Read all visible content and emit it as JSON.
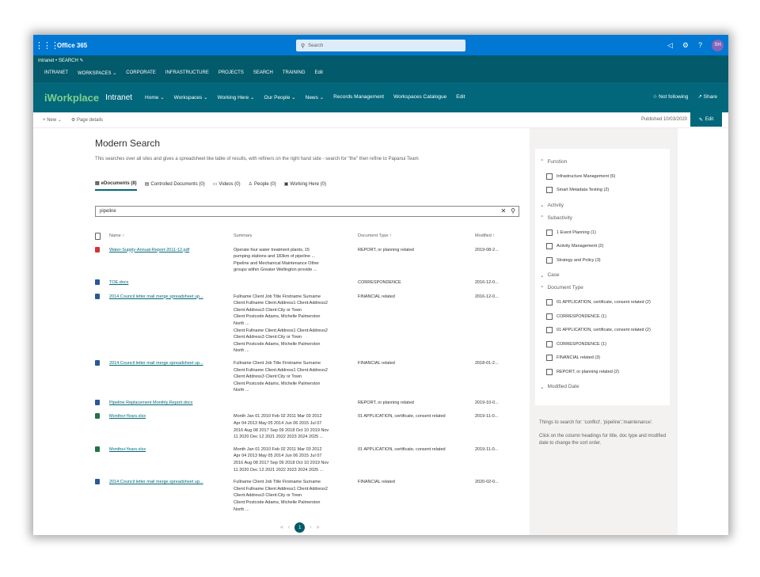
{
  "suitebar": {
    "app_name": "Office 365",
    "search_placeholder": "Search",
    "avatar_initials": "SH"
  },
  "hubnav": {
    "breadcrumb": [
      "Intranet",
      "SEARCH"
    ],
    "items": [
      "INTRANET",
      "WORKSPACES",
      "CORPORATE",
      "INFRASTRUCTURE",
      "PROJECTS",
      "SEARCH",
      "TRAINING",
      "Edit"
    ]
  },
  "site": {
    "logo": "iWorkplace",
    "title": "Intranet",
    "nav": [
      "Home",
      "Workspaces",
      "Working Here",
      "Our People",
      "News",
      "Records Management",
      "Workspaces Catalogue",
      "Edit"
    ],
    "follow_label": "Not following",
    "share_label": "Share"
  },
  "cmdbar": {
    "new_label": "New",
    "page_details_label": "Page details",
    "published": "Published 10/03/2020",
    "edit_label": "Edit"
  },
  "main": {
    "title": "Modern Search",
    "description": "This searches over all sites and gives a spreadsheet like table of results, with refiners on the right hand side - search for \"the\" then refine to Papanui Team",
    "tabs": [
      "eDocuments (8)",
      "Controlled Documents (0)",
      "Videos (0)",
      "People (0)",
      "Working Here (0)"
    ],
    "search_value": "pipeline",
    "columns": {
      "name": "Name",
      "summary": "Summary",
      "doc_type": "Document Type",
      "modified": "Modified"
    },
    "rows": [
      {
        "icon": "pdf",
        "name": "Water-Supply-Annual-Report-2011-12.pdf",
        "summary_lines": [
          "Operate four water treatment plants, 15",
          "pumping stations and 183km of pipeline ...",
          "Pipeline and Mechanical Maintenance Other",
          "groups within Greater Wellington provide ..."
        ],
        "doc_type": "REPORT, or planning related",
        "modified": "2019-08-2..."
      },
      {
        "icon": "word",
        "name": "TOE.docx",
        "summary_lines": [],
        "doc_type": "CORRESPONDENCE",
        "modified": "2016-12-0..."
      },
      {
        "icon": "word",
        "name": "2014 Council letter mail merge spreadsheet up...",
        "summary_lines": [
          "Fullname Client Job Title Firstname Surname",
          "Client:Fullname Client:Address1 Client:Address2",
          "Client:Address3 Client:City or Town",
          "Client:Postcode Adams, Michelle Palmerston",
          "North ...",
          "Client:Fullname Client:Address1 Client:Address2",
          "Client:Address3 Client:City or Town",
          "Client:Postcode Adams, Michelle Palmerston",
          "North ..."
        ],
        "doc_type": "FINANCIAL related",
        "modified": "2016-12-0..."
      },
      {
        "icon": "word",
        "name": "2014 Council letter mail merge spreadsheet up...",
        "summary_lines": [
          "Fullname Client Job Title Firstname Surname",
          "Client:Fullname Client:Address1 Client:Address2",
          "Client:Address3 Client:City or Town",
          "Client:Postcode Adams, Michelle Palmerston",
          "North ..."
        ],
        "doc_type": "FINANCIAL related",
        "modified": "2018-01-2..."
      },
      {
        "icon": "word",
        "name": "Pipeline Replacement Monthly Report.docx",
        "summary_lines": [],
        "doc_type": "REPORT, or planning related",
        "modified": "2019-10-0..."
      },
      {
        "icon": "excel",
        "name": "Months+Years.xlsx",
        "summary_lines": [
          "Month Jan 01 2010 Feb 02 2011 Mar 03 2012",
          "Apr 04 2013 May 05 2014 Jun 06 2015 Jul 07",
          "2016 Aug 08 2017 Sep 09 2018 Oct 10 2019 Nov",
          "11 2020 Dec 12 2021 2022 2023 2024 2025 ..."
        ],
        "doc_type": "01 APPLICATION, certificate, consent related",
        "modified": "2019-11-0..."
      },
      {
        "icon": "excel",
        "name": "Months+Years.xlsx",
        "summary_lines": [
          "Month Jan 01 2010 Feb 02 2011 Mar 03 2012",
          "Apr 04 2013 May 05 2014 Jun 06 2015 Jul 07",
          "2016 Aug 08 2017 Sep 09 2018 Oct 10 2019 Nov",
          "11 2020 Dec 12 2021 2022 2023 2024 2025 ..."
        ],
        "doc_type": "01 APPLICATION, certificate, consent related",
        "modified": "2019-11-0..."
      },
      {
        "icon": "word",
        "name": "2014 Council letter mail merge spreadsheet up...",
        "summary_lines": [
          "Fullname Client Job Title Firstname Surname",
          "Client:Fullname Client:Address1 Client:Address2",
          "Client:Address3 Client:City or Town",
          "Client:Postcode Adams, Michelle Palmerston",
          "North ..."
        ],
        "doc_type": "FINANCIAL related",
        "modified": "2020-02-0..."
      }
    ],
    "pagination": {
      "current": "1"
    }
  },
  "refiners": [
    {
      "title": "Function",
      "expanded": true,
      "items": [
        "Infrastructure Management (6)",
        "Smart Metadata Testing (2)"
      ]
    },
    {
      "title": "Activity",
      "expanded": false,
      "items": []
    },
    {
      "title": "Subactivity",
      "expanded": true,
      "items": [
        "1 Event Planning (1)",
        "Activity Management (2)",
        "Strategy and Policy (3)"
      ]
    },
    {
      "title": "Case",
      "expanded": false,
      "items": []
    },
    {
      "title": "Document Type",
      "expanded": true,
      "items": [
        "01 APPLICATION, certificate, consent related (2)",
        "CORRESPONDENCE (1)",
        "01 APPLICATION, certificate, consent related (2)",
        "CORRESPONDENCE (1)",
        "FINANCIAL related (3)",
        "REPORT, or planning related (2)"
      ]
    },
    {
      "title": "Modified Date",
      "expanded": false,
      "items": []
    }
  ],
  "help": [
    "Things to search for: 'conflict', 'pipeline','maintenance'.",
    "Click on the column headings for title, doc type and modified date to change the sort order."
  ]
}
